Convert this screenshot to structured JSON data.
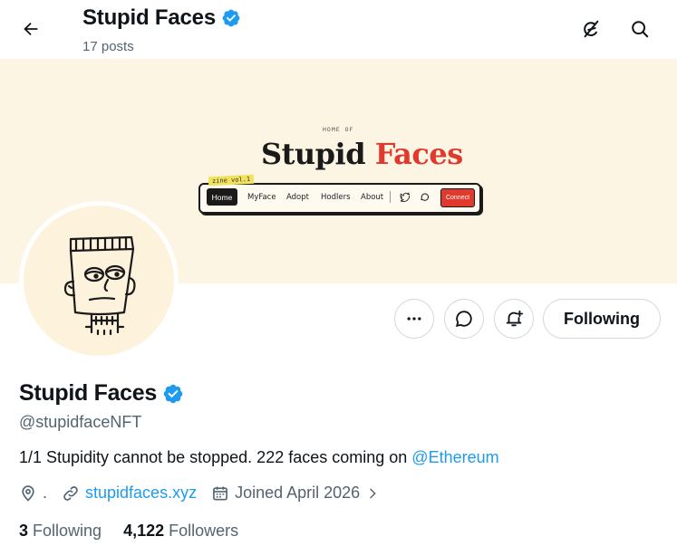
{
  "header": {
    "title": "Stupid Faces",
    "subtitle": "17 posts"
  },
  "banner": {
    "home_of": "HOME OF",
    "brand_word1": "Stupid",
    "brand_word2": "Faces",
    "zine": "zine vol.1",
    "nav": [
      "Home",
      "MyFace",
      "Adopt",
      "Hodlers",
      "About"
    ],
    "connect": "Connect"
  },
  "actions": {
    "following_label": "Following"
  },
  "profile": {
    "name": "Stupid Faces",
    "handle": "@stupidfaceNFT",
    "bio_text": "1/1 Stupidity cannot be stopped. 222 faces coming on ",
    "bio_mention": "@Ethereum",
    "location": ".",
    "website": "stupidfaces.xyz",
    "joined": "Joined April 2026",
    "following_count": "3",
    "following_label": "Following",
    "followers_count": "4,122",
    "followers_label": "Followers"
  },
  "colors": {
    "accent": "#1d9bf0",
    "banner_bg": "#fdf5e3",
    "brand_red": "#e03a2f",
    "verified": "#1d9bf0"
  },
  "icons": [
    "back-arrow-icon",
    "verified-badge-icon",
    "grok-icon",
    "search-icon",
    "more-icon",
    "message-icon",
    "notification-bell-icon",
    "location-icon",
    "link-icon",
    "calendar-icon",
    "chevron-right-icon"
  ]
}
